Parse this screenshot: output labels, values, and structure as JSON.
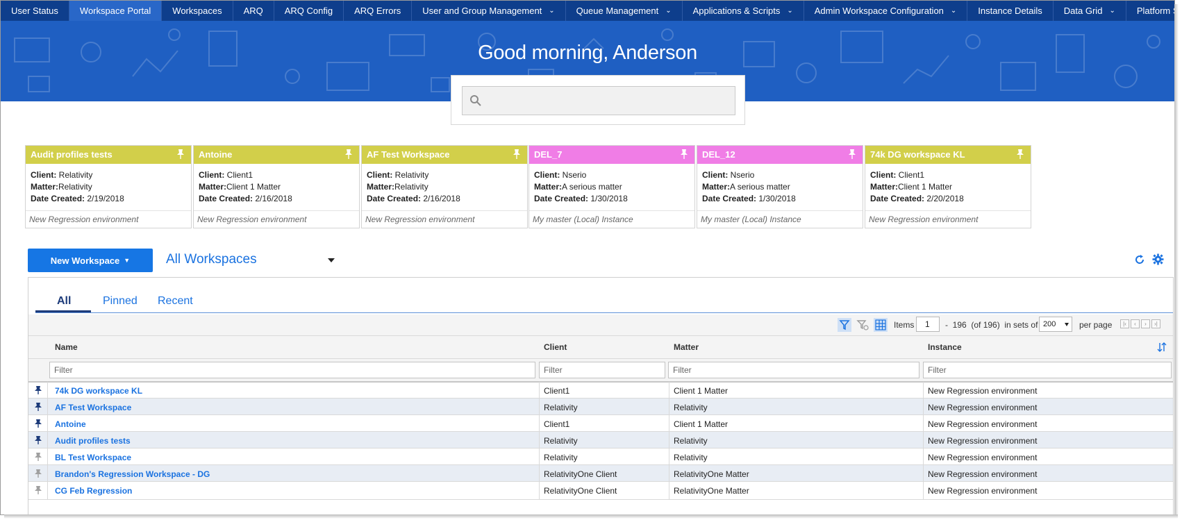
{
  "nav": {
    "tabs": [
      {
        "label": "User Status",
        "dropdown": false
      },
      {
        "label": "Workspace Portal",
        "dropdown": false,
        "active": true
      },
      {
        "label": "Workspaces",
        "dropdown": false
      },
      {
        "label": "ARQ",
        "dropdown": false
      },
      {
        "label": "ARQ Config",
        "dropdown": false
      },
      {
        "label": "ARQ Errors",
        "dropdown": false
      },
      {
        "label": "User and Group Management",
        "dropdown": true
      },
      {
        "label": "Queue Management",
        "dropdown": true
      },
      {
        "label": "Applications & Scripts",
        "dropdown": true
      },
      {
        "label": "Admin Workspace Configuration",
        "dropdown": true
      },
      {
        "label": "Instance Details",
        "dropdown": false
      },
      {
        "label": "Data Grid",
        "dropdown": true
      },
      {
        "label": "Platform Status",
        "dropdown": false
      }
    ],
    "dropdown_glyph": "⌄"
  },
  "hero": {
    "greeting": "Good morning, Anderson",
    "search_placeholder": ""
  },
  "cards": [
    {
      "title": "Audit profiles tests",
      "color": "#d2cf4a",
      "client_label": "Client:",
      "client": " Relativity",
      "matter_label": "Matter:",
      "matter": "Relativity",
      "date_label": "Date Created:",
      "date": " 2/19/2018",
      "instance": "New Regression environment"
    },
    {
      "title": "Antoine",
      "color": "#d2cf4a",
      "client_label": "Client:",
      "client": " Client1",
      "matter_label": "Matter:",
      "matter": "Client 1 Matter",
      "date_label": "Date Created:",
      "date": " 2/16/2018",
      "instance": "New Regression environment"
    },
    {
      "title": "AF Test Workspace",
      "color": "#d2cf4a",
      "client_label": "Client:",
      "client": " Relativity",
      "matter_label": "Matter:",
      "matter": "Relativity",
      "date_label": "Date Created:",
      "date": " 2/16/2018",
      "instance": "New Regression environment"
    },
    {
      "title": "DEL_7",
      "color": "#f07de6",
      "client_label": "Client:",
      "client": " Nserio",
      "matter_label": "Matter:",
      "matter": "A serious matter",
      "date_label": "Date Created:",
      "date": " 1/30/2018",
      "instance": "My master (Local) Instance"
    },
    {
      "title": "DEL_12",
      "color": "#f07de6",
      "client_label": "Client:",
      "client": " Nserio",
      "matter_label": "Matter:",
      "matter": "A serious matter",
      "date_label": "Date Created:",
      "date": " 1/30/2018",
      "instance": "My master (Local) Instance"
    },
    {
      "title": "74k DG workspace KL",
      "color": "#d2cf4a",
      "client_label": "Client:",
      "client": " Client1",
      "matter_label": "Matter:",
      "matter": "Client 1 Matter",
      "date_label": "Date Created:",
      "date": " 2/20/2018",
      "instance": "New Regression environment"
    }
  ],
  "toolbar": {
    "new_workspace_label": "New Workspace",
    "view_label": "All Workspaces"
  },
  "grid": {
    "tabs": [
      "All",
      "Pinned",
      "Recent"
    ],
    "pager": {
      "items_label": "Items",
      "page_value": "1",
      "range_text": "-  196  (of 196)  in sets of",
      "set_size": "200",
      "per_page_label": "per page"
    },
    "columns": [
      "Name",
      "Client",
      "Matter",
      "Instance"
    ],
    "filter_placeholder": "Filter",
    "rows": [
      {
        "pinned": true,
        "name": "74k DG workspace KL",
        "client": "Client1",
        "matter": "Client 1 Matter",
        "instance": "New Regression environment"
      },
      {
        "pinned": true,
        "name": "AF Test Workspace",
        "client": "Relativity",
        "matter": "Relativity",
        "instance": "New Regression environment"
      },
      {
        "pinned": true,
        "name": "Antoine",
        "client": "Client1",
        "matter": "Client 1 Matter",
        "instance": "New Regression environment"
      },
      {
        "pinned": true,
        "name": "Audit profiles tests",
        "client": "Relativity",
        "matter": "Relativity",
        "instance": "New Regression environment"
      },
      {
        "pinned": false,
        "name": "BL Test Workspace",
        "client": "Relativity",
        "matter": "Relativity",
        "instance": "New Regression environment"
      },
      {
        "pinned": false,
        "name": "Brandon's Regression Workspace - DG",
        "client": "RelativityOne Client",
        "matter": "RelativityOne Matter",
        "instance": "New Regression environment"
      },
      {
        "pinned": false,
        "name": "CG Feb Regression",
        "client": "RelativityOne Client",
        "matter": "RelativityOne Matter",
        "instance": "New Regression environment"
      }
    ]
  },
  "colors": {
    "nav_bg": "#0e3e8c",
    "nav_active": "#2967c8",
    "hero_bg": "#1f5fc2",
    "link_blue": "#1a72e0",
    "button_blue": "#1676e4",
    "card_yellow": "#d2cf4a",
    "card_pink": "#f07de6"
  }
}
